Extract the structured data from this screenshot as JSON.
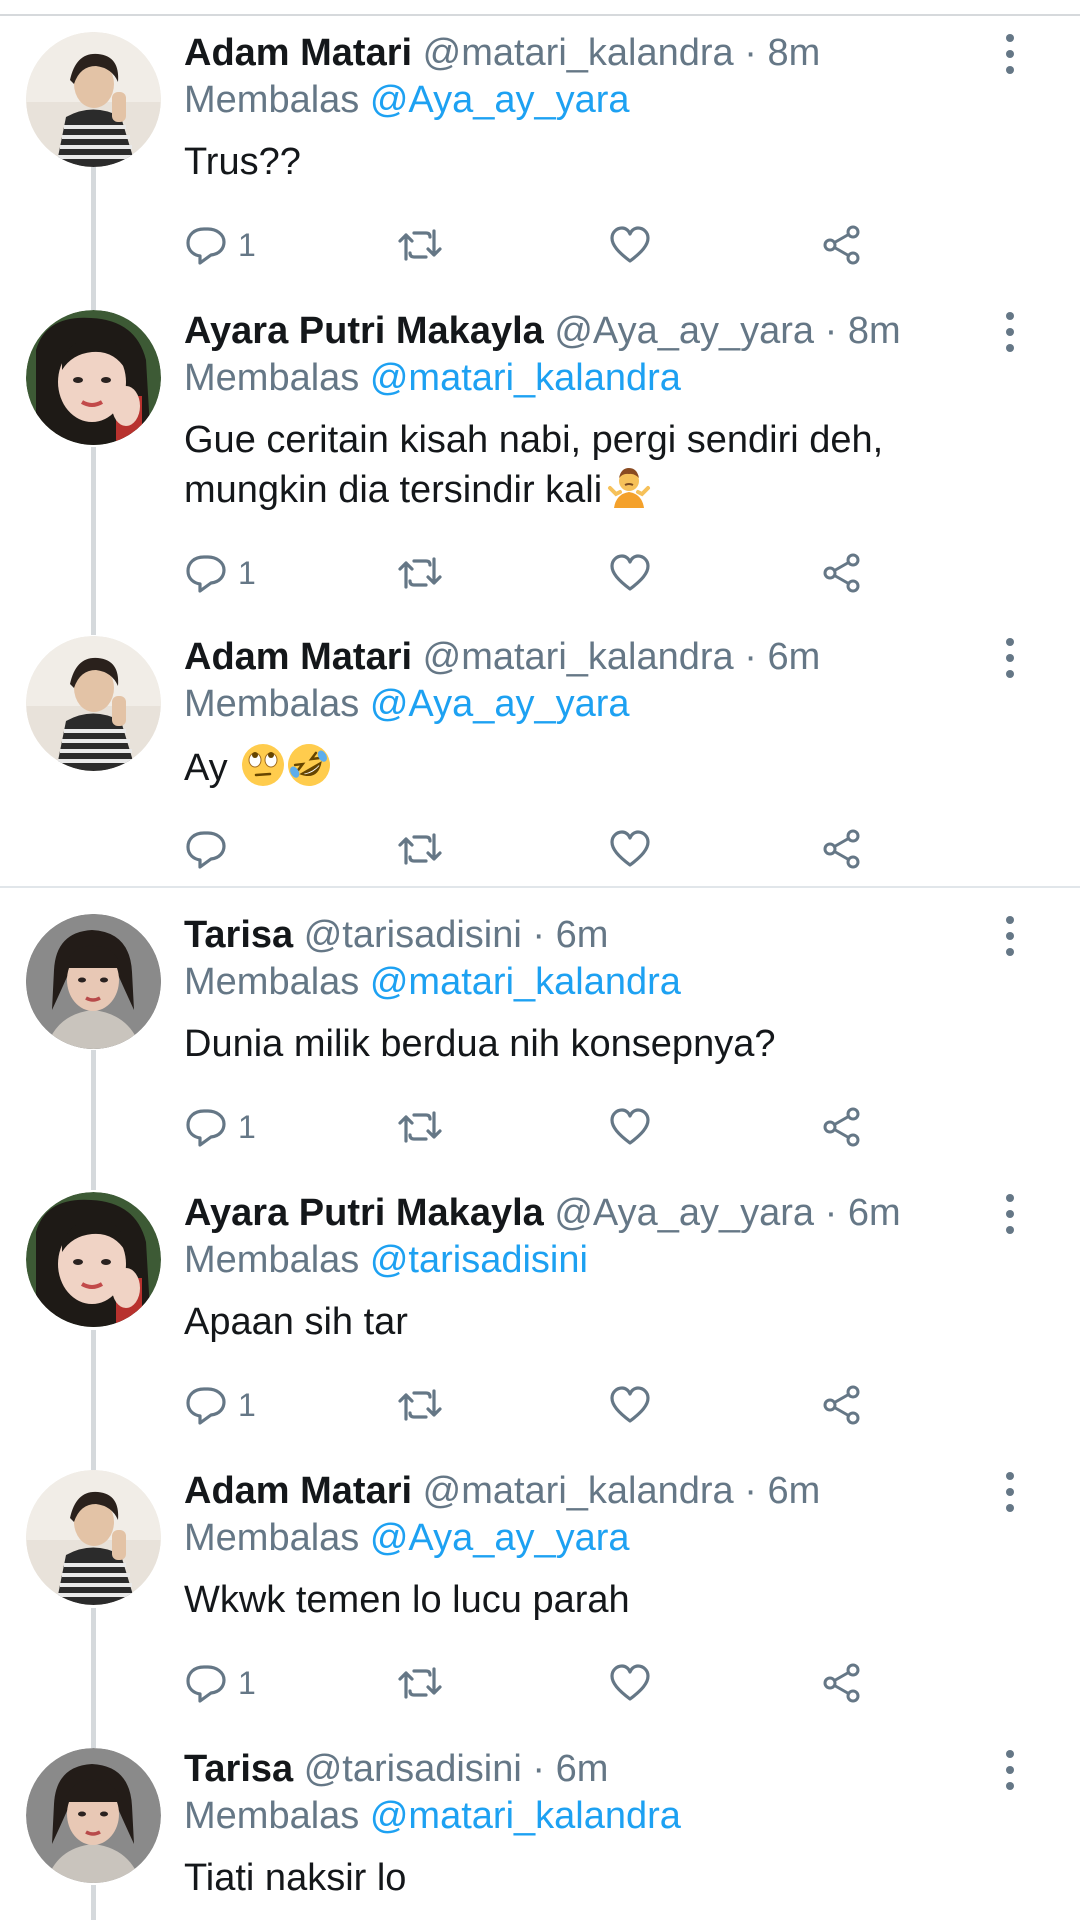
{
  "reply_prefix": "Membalas",
  "colors": {
    "accent": "#1da1f2",
    "secondary": "#657786",
    "text": "#14171a"
  },
  "icons": {
    "reply": "reply-icon",
    "retweet": "retweet-icon",
    "like": "heart-icon",
    "share": "share-icon",
    "more": "more-vertical-icon"
  },
  "tweets": [
    {
      "name": "Adam Matari",
      "handle": "@matari_kalandra",
      "sep": "·",
      "time": "8m",
      "reply_to": "@Aya_ay_yara",
      "text": "Trus??",
      "emoji": "",
      "reply_count": "1"
    },
    {
      "name": "Ayara Putri Makayla",
      "handle": "@Aya_ay_yara",
      "sep": "·",
      "time": "8m",
      "reply_to": "@matari_kalandra",
      "text": "Gue ceritain kisah nabi, pergi sendiri deh, mungkin dia tersindir kali",
      "emoji": "person-shrugging",
      "reply_count": "1"
    },
    {
      "name": "Adam Matari",
      "handle": "@matari_kalandra",
      "sep": "·",
      "time": "6m",
      "reply_to": "@Aya_ay_yara",
      "text": "Ay",
      "emoji": "eye-roll, rolling-on-floor-laughing",
      "reply_count": ""
    },
    {
      "name": "Tarisa",
      "handle": "@tarisadisini",
      "sep": "·",
      "time": "6m",
      "reply_to": "@matari_kalandra",
      "text": "Dunia milik berdua nih konsepnya?",
      "emoji": "",
      "reply_count": "1"
    },
    {
      "name": "Ayara Putri Makayla",
      "handle": "@Aya_ay_yara",
      "sep": "·",
      "time": "6m",
      "reply_to": "@tarisadisini",
      "text": "Apaan sih tar",
      "emoji": "",
      "reply_count": "1"
    },
    {
      "name": "Adam Matari",
      "handle": "@matari_kalandra",
      "sep": "·",
      "time": "6m",
      "reply_to": "@Aya_ay_yara",
      "text": "Wkwk temen lo lucu parah",
      "emoji": "",
      "reply_count": "1"
    },
    {
      "name": "Tarisa",
      "handle": "@tarisadisini",
      "sep": "·",
      "time": "6m",
      "reply_to": "@matari_kalandra",
      "text": "Tiati naksir lo",
      "emoji": "",
      "reply_count": ""
    }
  ]
}
